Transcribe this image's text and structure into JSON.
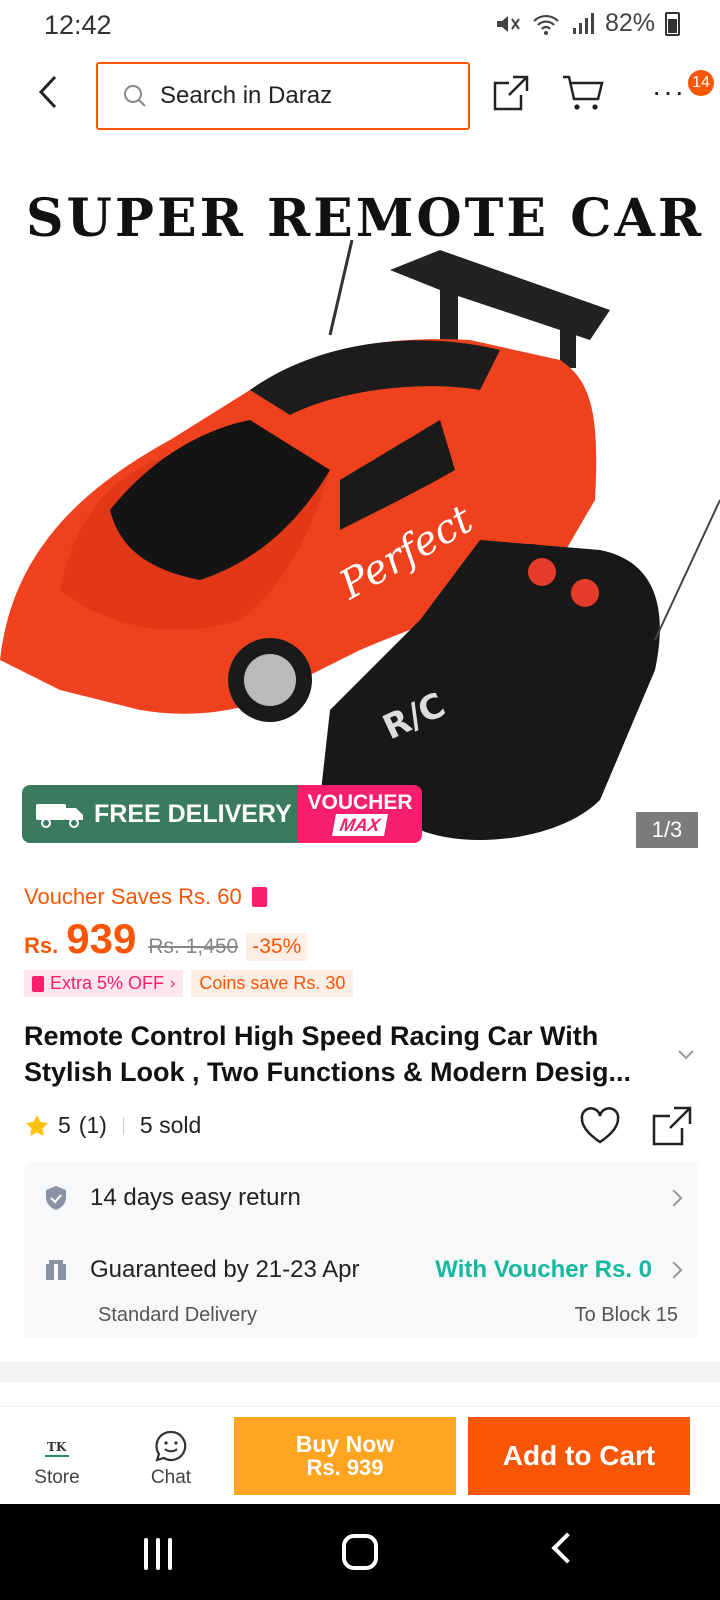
{
  "status": {
    "time": "12:42",
    "battery": "82%"
  },
  "search": {
    "placeholder": "Search in Daraz"
  },
  "topbar": {
    "badge": "14"
  },
  "hero": {
    "title": "SUPER REMOTE CAR",
    "pager": "1/3",
    "script_text": "Perfect",
    "free_delivery": "FREE DELIVERY",
    "voucher": "VOUCHER",
    "max": "MAX"
  },
  "product": {
    "voucher_saves": "Voucher Saves Rs. 60",
    "currency": "Rs.",
    "price": "939",
    "old_price": "Rs. 1,450",
    "discount": "-35%",
    "chip_extra": "Extra 5% OFF",
    "chip_coins": "Coins save Rs. 30",
    "title_line1": "Remote Control High Speed Racing Car With",
    "title_line2": "Stylish Look , Two Functions & Modern Desig...",
    "rating": "5",
    "rating_count": "(1)",
    "sold": "5 sold"
  },
  "service": {
    "return": "14 days easy return",
    "guarantee": "Guaranteed by 21-23 Apr",
    "with_voucher": "With Voucher Rs. 0",
    "standard": "Standard Delivery",
    "to": "To Block 15"
  },
  "actions": {
    "store": "Store",
    "chat": "Chat",
    "buy_now": "Buy Now",
    "buy_price": "Rs. 939",
    "add_to_cart": "Add to Cart"
  },
  "colors": {
    "accent": "#f85606",
    "buy": "#ffa51f",
    "teal": "#16b8a0",
    "pink": "#f81e6c",
    "free_green": "#3a7a5e"
  }
}
